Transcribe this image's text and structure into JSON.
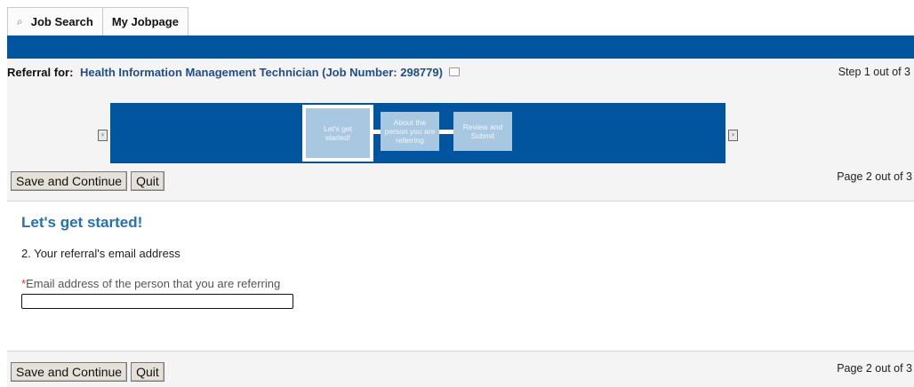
{
  "tabs": [
    {
      "label": "Job Search",
      "icon": "search-icon"
    },
    {
      "label": "My Jobpage"
    }
  ],
  "header": {
    "referral_label": "Referral for:",
    "job_title": "Health Information Management Technician (Job Number: 298779)",
    "step_text": "Step 1 out of 3"
  },
  "progress": {
    "steps": [
      {
        "label": "Let's get started!",
        "active": true
      },
      {
        "label": "About the person you are referring",
        "active": false
      },
      {
        "label": "Review and Submit",
        "active": false
      }
    ],
    "prev_icon": "chevron-left-icon",
    "next_icon": "chevron-right-icon"
  },
  "buttons": {
    "save_continue": "Save and Continue",
    "quit": "Quit"
  },
  "page_text": "Page 2 out of 3",
  "form": {
    "section_title": "Let's get started!",
    "question": "2. Your referral's email address",
    "required_mark": "*",
    "email_label": "Email address of the person that you are referring",
    "email_value": ""
  },
  "colors": {
    "brand_blue": "#00559f",
    "step_box": "#a8c8e2",
    "title_blue": "#2173b6",
    "job_link": "#1f4e8c"
  }
}
